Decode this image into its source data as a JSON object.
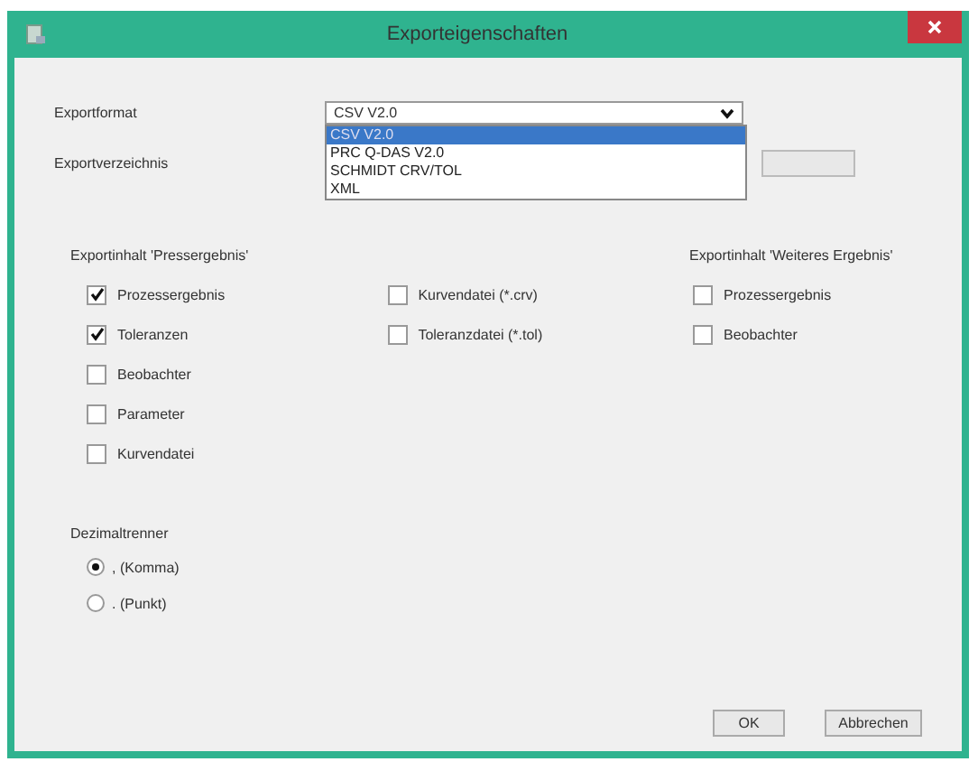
{
  "window": {
    "title": "Exporteigenschaften"
  },
  "export_format": {
    "label": "Exportformat",
    "value": "CSV V2.0",
    "expanded": true,
    "options": [
      {
        "label": "CSV V2.0",
        "selected": true
      },
      {
        "label": "PRC Q-DAS V2.0",
        "selected": false
      },
      {
        "label": "SCHMIDT CRV/TOL",
        "selected": false
      },
      {
        "label": "XML",
        "selected": false
      }
    ]
  },
  "export_directory": {
    "label": "Exportverzeichnis"
  },
  "groups": [
    {
      "title": "Exportinhalt 'Pressergebnis'",
      "columns": [
        [
          {
            "label": "Prozessergebnis",
            "checked": true
          },
          {
            "label": "Toleranzen",
            "checked": true
          },
          {
            "label": "Beobachter",
            "checked": false
          },
          {
            "label": "Parameter",
            "checked": false
          },
          {
            "label": "Kurvendatei",
            "checked": false
          }
        ],
        [
          {
            "label": "Kurvendatei (*.crv)",
            "checked": false
          },
          {
            "label": "Toleranzdatei (*.tol)",
            "checked": false
          }
        ]
      ]
    },
    {
      "title": "Exportinhalt 'Weiteres Ergebnis'",
      "columns": [
        [
          {
            "label": "Prozessergebnis",
            "checked": false
          },
          {
            "label": "Beobachter",
            "checked": false
          }
        ]
      ]
    }
  ],
  "decimal_separator": {
    "label": "Dezimaltrenner",
    "options": [
      {
        "label": ", (Komma)",
        "selected": true
      },
      {
        "label": ". (Punkt)",
        "selected": false
      }
    ]
  },
  "buttons": [
    "OK",
    "Abbrechen"
  ]
}
